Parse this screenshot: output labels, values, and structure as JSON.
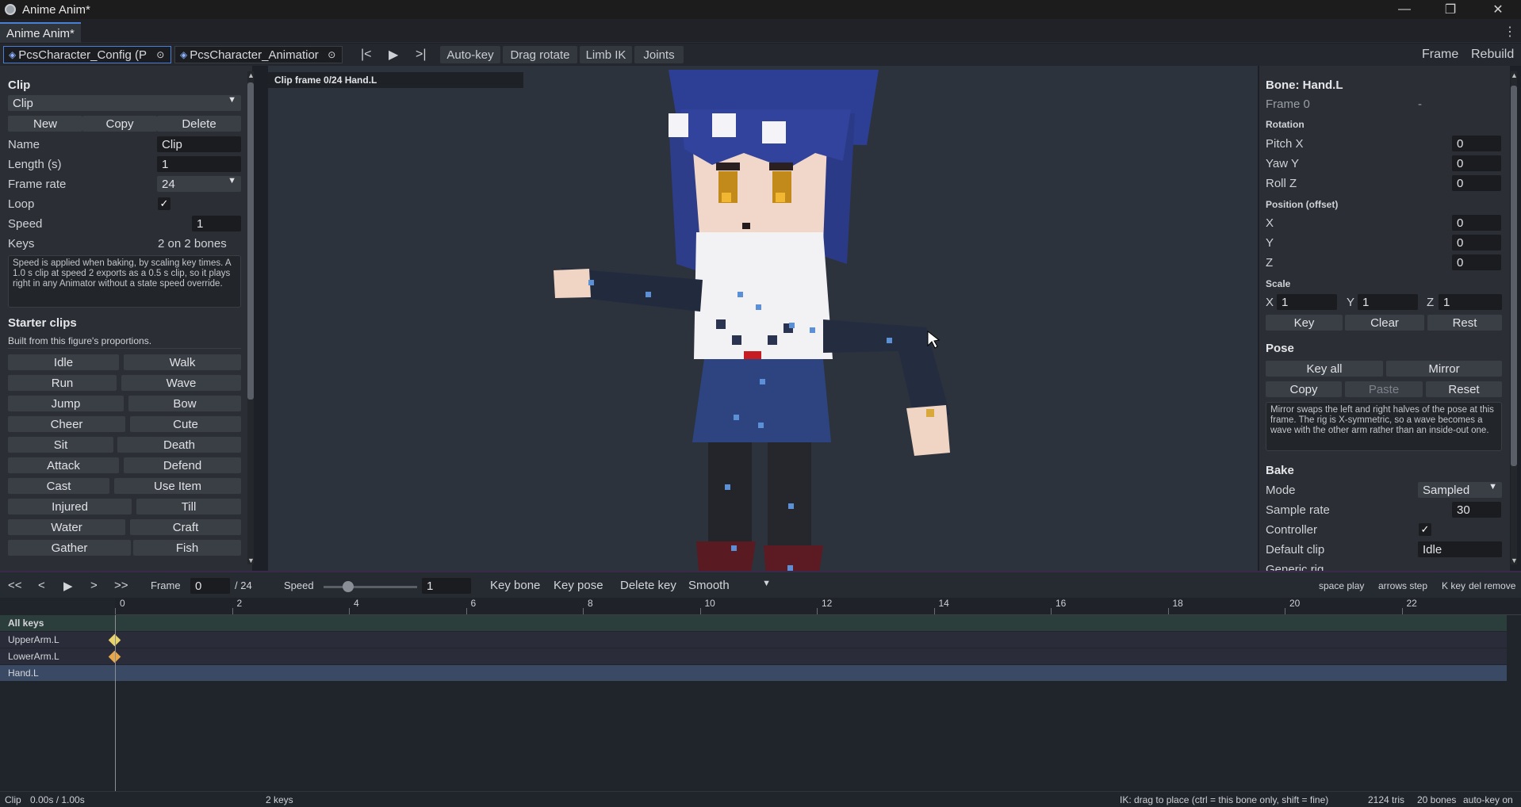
{
  "window": {
    "title": "Anime Anim*",
    "minimize": "—",
    "maximize": "❐",
    "close": "✕"
  },
  "tabs": {
    "active": "Anime Anim*",
    "menu": "⋮"
  },
  "toolbar": {
    "scene_tabs": [
      "PcsCharacter_Config (P",
      "PcsCharacter_Animatior"
    ],
    "nav_first": "|<",
    "nav_play": "▶",
    "nav_last": ">|",
    "buttons": [
      "Auto-key",
      "Drag rotate",
      "Limb IK",
      "Joints"
    ],
    "right": [
      "Frame",
      "Rebuild"
    ]
  },
  "left": {
    "clip_header": "Clip",
    "clip_select": "Clip",
    "actions": [
      "New",
      "Copy",
      "Delete"
    ],
    "name_label": "Name",
    "name_value": "Clip",
    "length_label": "Length (s)",
    "length_value": "1",
    "framerate_label": "Frame rate",
    "framerate_value": "24",
    "loop_label": "Loop",
    "loop_checked": "✓",
    "speed_label": "Speed",
    "speed_value": "1",
    "keys_label": "Keys",
    "keys_value": "2 on 2 bones",
    "note": "Speed is applied when baking, by scaling key times. A 1.0 s clip at speed 2 exports as a 0.5 s clip, so it plays right in any Animator without a state speed override.",
    "starter_header": "Starter clips",
    "starter_sub": "Built from this figure's proportions.",
    "starters": [
      [
        "Idle",
        "Walk"
      ],
      [
        "Run",
        "Wave"
      ],
      [
        "Jump",
        "Bow"
      ],
      [
        "Cheer",
        "Cute"
      ],
      [
        "Sit",
        "Death"
      ],
      [
        "Attack",
        "Defend"
      ],
      [
        "Cast",
        "Use Item"
      ],
      [
        "Injured",
        "Till"
      ],
      [
        "Water",
        "Craft"
      ],
      [
        "Gather",
        "Fish"
      ]
    ]
  },
  "viewport": {
    "label": "Clip   frame 0/24   Hand.L"
  },
  "right": {
    "bone_header": "Bone: Hand.L",
    "frame_label": "Frame 0",
    "frame_value": "-",
    "rotation_header": "Rotation",
    "pitch_label": "Pitch X",
    "pitch_value": "0",
    "yaw_label": "Yaw Y",
    "yaw_value": "0",
    "roll_label": "Roll Z",
    "roll_value": "0",
    "position_header": "Position (offset)",
    "px_label": "X",
    "px_value": "0",
    "py_label": "Y",
    "py_value": "0",
    "pz_label": "Z",
    "pz_value": "0",
    "scale_header": "Scale",
    "sx_label": "X",
    "sx_value": "1",
    "sy_label": "Y",
    "sy_value": "1",
    "sz_label": "Z",
    "sz_value": "1",
    "bone_actions": [
      "Key",
      "Clear",
      "Rest"
    ],
    "pose_header": "Pose",
    "pose_row1": [
      "Key all",
      "Mirror"
    ],
    "pose_row2": [
      "Copy",
      "Paste",
      "Reset"
    ],
    "pose_note": "Mirror swaps the left and right halves of the pose at this frame. The rig is X-symmetric, so a wave becomes a wave with the other arm rather than an inside-out one.",
    "bake_header": "Bake",
    "mode_label": "Mode",
    "mode_value": "Sampled",
    "samplerate_label": "Sample rate",
    "samplerate_value": "30",
    "controller_label": "Controller",
    "controller_checked": "✓",
    "defaultclip_label": "Default clip",
    "defaultclip_value": "Idle",
    "generic_label": "Generic rig"
  },
  "timeline": {
    "transport": [
      "<<",
      "<",
      "▶",
      ">",
      ">>"
    ],
    "frame_label": "Frame",
    "frame_value": "0",
    "frame_total": "/ 24",
    "speed_label": "Speed",
    "speed_value": "1",
    "speed_level": 0.1,
    "key_bone": "Key bone",
    "key_pose": "Key pose",
    "delete_key": "Delete key",
    "interp": "Smooth",
    "hints": [
      "space play",
      "arrows step",
      "K key",
      "del remove"
    ],
    "ruler": [
      "0",
      "2",
      "4",
      "6",
      "8",
      "10",
      "12",
      "14",
      "16",
      "18",
      "20",
      "22"
    ],
    "tracks": [
      "All keys",
      "UpperArm.L",
      "LowerArm.L",
      "Hand.L"
    ],
    "key_colors": {
      "upper": "#e8d26a",
      "lower": "#e8a84a"
    }
  },
  "status": {
    "clip": "Clip",
    "time": "0.00s / 1.00s",
    "keys": "2 keys",
    "hint": "IK: drag to place  (ctrl = this bone only, shift = fine)",
    "tris": "2124 tris",
    "bones": "20 bones",
    "autokey": "auto-key on"
  }
}
